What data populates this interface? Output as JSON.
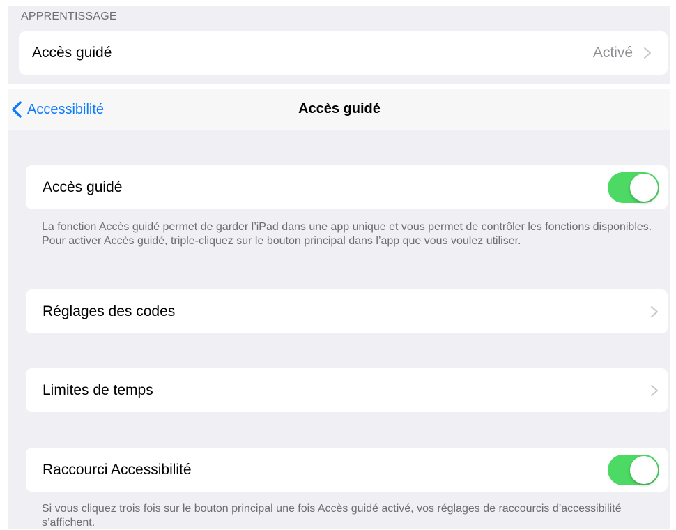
{
  "learning_section": {
    "header": "APPRENTISSAGE",
    "row": {
      "label": "Accès guidé",
      "value": "Activé",
      "chevron_icon": "chevron-right-icon"
    }
  },
  "navbar": {
    "back_label": "Accessibilité",
    "back_icon": "chevron-left-icon",
    "title": "Accès guidé"
  },
  "rows": [
    {
      "label": "Accès guidé",
      "toggle_on": true
    },
    {
      "label": "Réglages des codes",
      "chevron_icon": "chevron-right-icon"
    },
    {
      "label": "Limites de temps",
      "chevron_icon": "chevron-right-icon"
    },
    {
      "label": "Raccourci Accessibilité",
      "toggle_on": true
    }
  ],
  "footnotes": {
    "guided_access": "La fonction Accès guidé permet de garder l’iPad dans une app unique et vous permet de contrôler les fonctions disponibles. Pour activer Accès guidé, triple-cliquez sur le bouton principal dans l’app que vous voulez utiliser.",
    "shortcut": "Si vous cliquez trois fois sur le bouton principal une fois Accès guidé activé, vos réglages de raccourcis d’accessibilité s’affichent."
  },
  "colors": {
    "tint": "#0a7aff",
    "toggle_on": "#4cd964",
    "grouped_background": "#efeff4",
    "secondary_text": "#6d6d72",
    "detail_text": "#8e8e93",
    "chevron": "#c7c7cc"
  }
}
